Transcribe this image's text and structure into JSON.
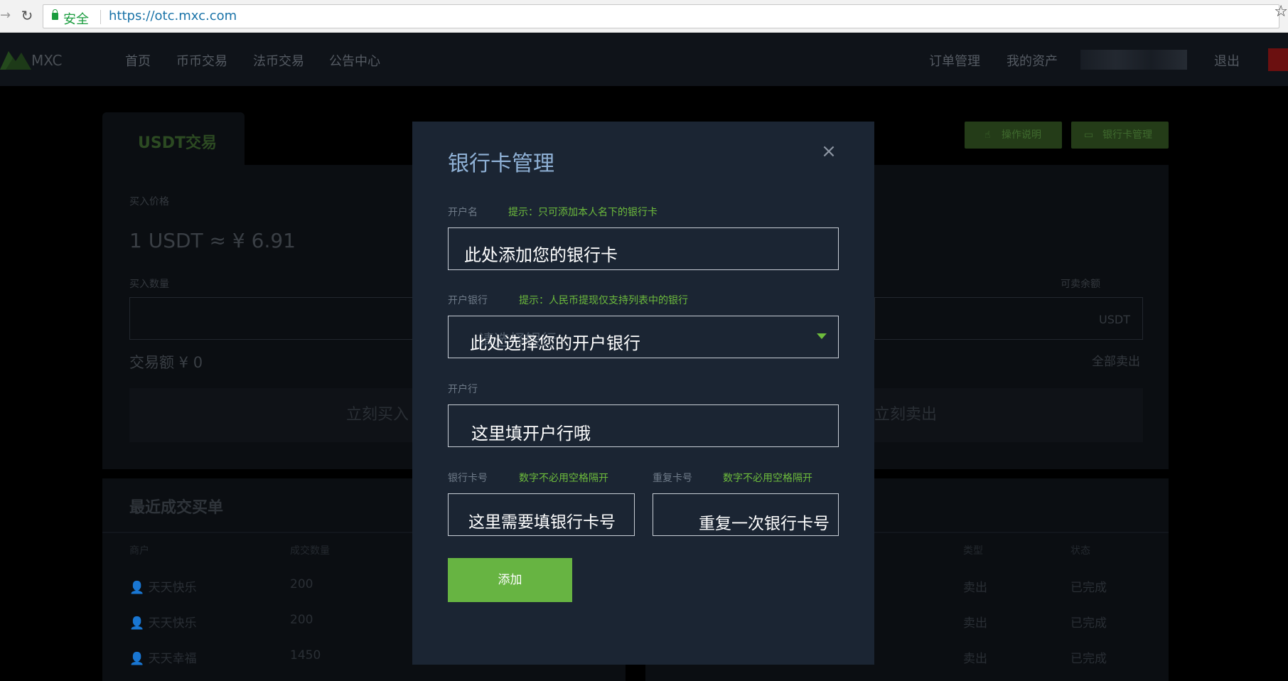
{
  "browser": {
    "secure_label": "安全",
    "url": "https://otc.mxc.com"
  },
  "nav": {
    "logo": "MXC",
    "left_items": [
      "首页",
      "币币交易",
      "法币交易",
      "公告中心"
    ],
    "right_items": [
      "订单管理",
      "我的资产",
      "退出"
    ]
  },
  "background": {
    "tab_label": "USDT交易",
    "buy_price_label": "买入价格",
    "price": "1 USDT ≈ ¥ 6.91",
    "buy_qty_label": "买入数量",
    "trade_amount": "交易额  ¥ 0",
    "buy_button": "立刻买入",
    "sellable_label": "可卖余额",
    "usdt_suffix": "USDT",
    "sell_all": "全部卖出",
    "sell_button": "立刻卖出",
    "guide_button": "操作说明",
    "bank_button": "银行卡管理",
    "recent_title": "最近成交买单",
    "table_headers": [
      "商户",
      "成交数量",
      "类型",
      "状态"
    ],
    "rows": [
      {
        "merchant": "天天快乐",
        "qty": "200",
        "type": "卖出",
        "status": "已完成"
      },
      {
        "merchant": "天天快乐",
        "qty": "200",
        "type": "卖出",
        "status": "已完成"
      },
      {
        "merchant": "天天幸福",
        "qty": "1450",
        "type": "卖出",
        "status": "已完成"
      }
    ]
  },
  "modal": {
    "title": "银行卡管理",
    "close": "×",
    "holder_label": "开户名",
    "holder_hint": "提示：只可添加本人名下的银行卡",
    "holder_placeholder": "此处添加您的银行卡",
    "bank_label": "开户银行",
    "bank_hint": "提示：人民币提现仅支持列表中的银行",
    "bank_placeholder_dim": "请选择银行",
    "bank_placeholder": "此处选择您的开户银行",
    "branch_label": "开户行",
    "branch_placeholder": "这里填开户行哦",
    "card_label": "银行卡号",
    "card_hint": "数字不必用空格隔开",
    "card_placeholder": "这里需要填银行卡号",
    "repeat_label": "重复卡号",
    "repeat_hint": "数字不必用空格隔开",
    "repeat_placeholder": "重复一次银行卡号",
    "add_button": "添加"
  },
  "colors": {
    "modal_bg": "#1b2533",
    "accent_green": "#67b442",
    "hint_green": "#6dbc3c",
    "title_blue": "#8fb1d6"
  }
}
